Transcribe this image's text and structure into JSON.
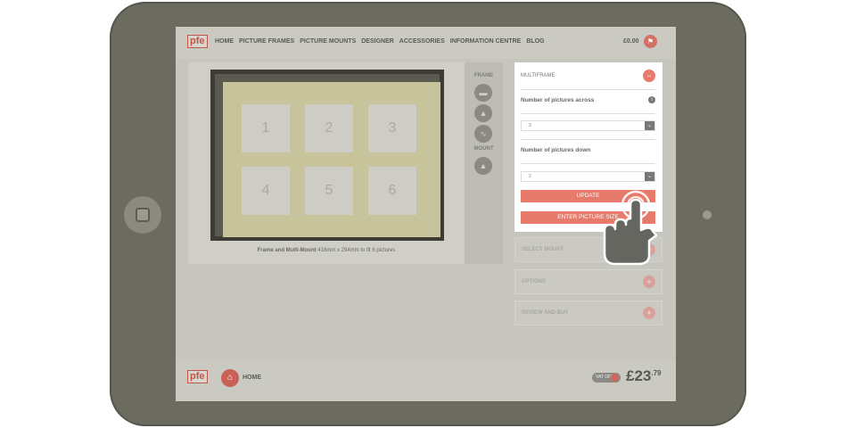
{
  "nav": {
    "logo": "pfe",
    "items": [
      "HOME",
      "PICTURE FRAMES",
      "PICTURE MOUNTS",
      "DESIGNER",
      "ACCESSORIES",
      "INFORMATION CENTRE",
      "BLOG"
    ],
    "cart_total": "£0.00"
  },
  "canvas": {
    "apertures": [
      "1",
      "2",
      "3",
      "4",
      "5",
      "6"
    ],
    "caption_bold": "Frame and Multi-Mount",
    "caption_rest": " 416mm x 294mm to fit 6 pictures"
  },
  "tools": {
    "frame_label": "FRAME",
    "mount_label": "MOUNT"
  },
  "multiframe": {
    "title": "MULTIFRAME",
    "across_label": "Number of pictures across",
    "across_value": "3",
    "down_label": "Number of pictures down",
    "down_value": "2",
    "update_label": "UPDATE",
    "enter_size_label": "ENTER PICTURE SIZE"
  },
  "accordion": [
    "SELECT MOUNT",
    "OPTIONS",
    "REVIEW AND BUY"
  ],
  "footer": {
    "logo": "pfe",
    "home_label": "HOME",
    "vat_label": "VAT OFF",
    "total_main": "£23",
    "total_pence": ".79"
  },
  "colors": {
    "accent": "#e77a6b",
    "tablet_body": "#6b6b5f",
    "screen_overlay": "#c6c6bf"
  }
}
